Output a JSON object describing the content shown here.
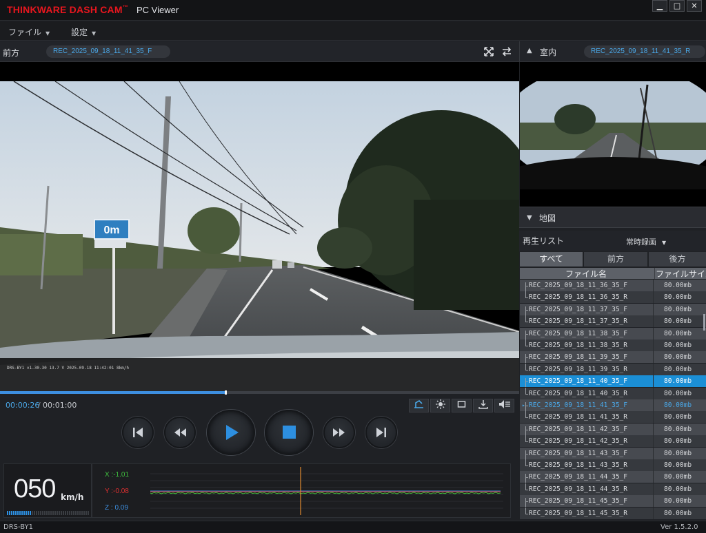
{
  "window": {
    "brand": "THINKWARE DASH CAM",
    "brand_mark": "™",
    "app_title": "PC Viewer",
    "minimize_label": "▁",
    "maximize_label": "□",
    "close_label": "✕"
  },
  "menu": {
    "file_label": "ファイル",
    "settings_label": "設定"
  },
  "front": {
    "label": "前方",
    "file": "REC_2025_09_18_11_41_35_F",
    "sign_text": "0m",
    "overlay_text": "DRS-BY1   v1.30.30  13.7 V        2025.09.18 11:42:01   8km/h"
  },
  "rear": {
    "label": "室内",
    "file": "REC_2025_09_18_11_41_35_R"
  },
  "playback": {
    "current_time": "00:00:26",
    "separator": "/",
    "total_time": "00:01:00",
    "progress_fraction": 0.433
  },
  "speed": {
    "value": "050",
    "unit": "km/h",
    "bar_fraction": 0.3
  },
  "gsensor": {
    "x_label": "X :-1.01",
    "y_label": "Y :-0.08",
    "z_label": "Z : 0.09",
    "x_color": "#3fbf3f",
    "y_color": "#e03030",
    "z_color": "#3d8fe0"
  },
  "map": {
    "label": "地図"
  },
  "playlist": {
    "title": "再生リスト",
    "mode": "常時録画",
    "tabs": [
      "すべて",
      "前方",
      "後方"
    ],
    "col_name": "ファイル名",
    "col_size": "ファイルサイズ",
    "files": [
      {
        "name": "REC_2025_09_18_11_36_35_F",
        "size": "80.00mb"
      },
      {
        "name": "REC_2025_09_18_11_36_35_R",
        "size": "80.00mb"
      },
      {
        "name": "REC_2025_09_18_11_37_35_F",
        "size": "80.00mb"
      },
      {
        "name": "REC_2025_09_18_11_37_35_R",
        "size": "80.00mb"
      },
      {
        "name": "REC_2025_09_18_11_38_35_F",
        "size": "80.00mb"
      },
      {
        "name": "REC_2025_09_18_11_38_35_R",
        "size": "80.00mb"
      },
      {
        "name": "REC_2025_09_18_11_39_35_F",
        "size": "80.00mb"
      },
      {
        "name": "REC_2025_09_18_11_39_35_R",
        "size": "80.00mb"
      },
      {
        "name": "REC_2025_09_18_11_40_35_F",
        "size": "80.00mb"
      },
      {
        "name": "REC_2025_09_18_11_40_35_R",
        "size": "80.00mb"
      },
      {
        "name": "REC_2025_09_18_11_41_35_F",
        "size": "80.00mb"
      },
      {
        "name": "REC_2025_09_18_11_41_35_R",
        "size": "80.00mb"
      },
      {
        "name": "REC_2025_09_18_11_42_35_F",
        "size": "80.00mb"
      },
      {
        "name": "REC_2025_09_18_11_42_35_R",
        "size": "80.00mb"
      },
      {
        "name": "REC_2025_09_18_11_43_35_F",
        "size": "80.00mb"
      },
      {
        "name": "REC_2025_09_18_11_43_35_R",
        "size": "80.00mb"
      },
      {
        "name": "REC_2025_09_18_11_44_35_F",
        "size": "80.00mb"
      },
      {
        "name": "REC_2025_09_18_11_44_35_R",
        "size": "80.00mb"
      },
      {
        "name": "REC_2025_09_18_11_45_35_F",
        "size": "80.00mb"
      },
      {
        "name": "REC_2025_09_18_11_45_35_R",
        "size": "80.00mb"
      }
    ],
    "selected_index": 8,
    "current_index": 10
  },
  "status": {
    "device": "DRS-BY1",
    "version": "Ver 1.5.2.0"
  },
  "icons": {
    "fullscreen": "fullscreen-icon",
    "swap": "swap-icon",
    "collapse": "triangle-up-icon",
    "capture": "capture-icon",
    "brightness": "brightness-icon",
    "aspect": "aspect-icon",
    "download": "download-icon",
    "volume": "volume-icon"
  },
  "colors": {
    "brand_red": "#e8161e",
    "accent_blue": "#1b8fd6",
    "text_blue": "#4aa8e8"
  }
}
